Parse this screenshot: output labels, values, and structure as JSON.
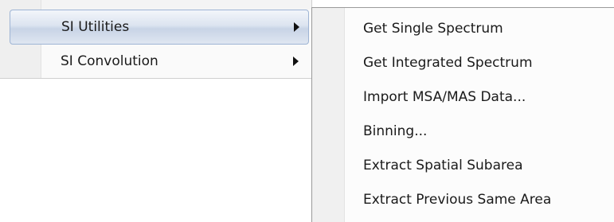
{
  "parent_menu": {
    "items": [
      {
        "label": "SI Utilities",
        "active": true,
        "has_submenu": true
      },
      {
        "label": "SI Convolution",
        "active": false,
        "has_submenu": true
      }
    ]
  },
  "submenu": {
    "items": [
      {
        "label": "Get Single Spectrum"
      },
      {
        "label": "Get Integrated Spectrum"
      },
      {
        "label": "Import MSA/MAS Data..."
      },
      {
        "label": "Binning..."
      },
      {
        "label": "Extract Spatial Subarea"
      },
      {
        "label": "Extract Previous Same Area"
      }
    ]
  },
  "icons": {
    "submenu_arrow": "chevron-right-icon"
  },
  "colors": {
    "highlight_border": "#9eb4d4",
    "highlight_fill": "#d6dfec",
    "menu_background": "#fcfcfc",
    "gutter": "#f0f0f0"
  }
}
